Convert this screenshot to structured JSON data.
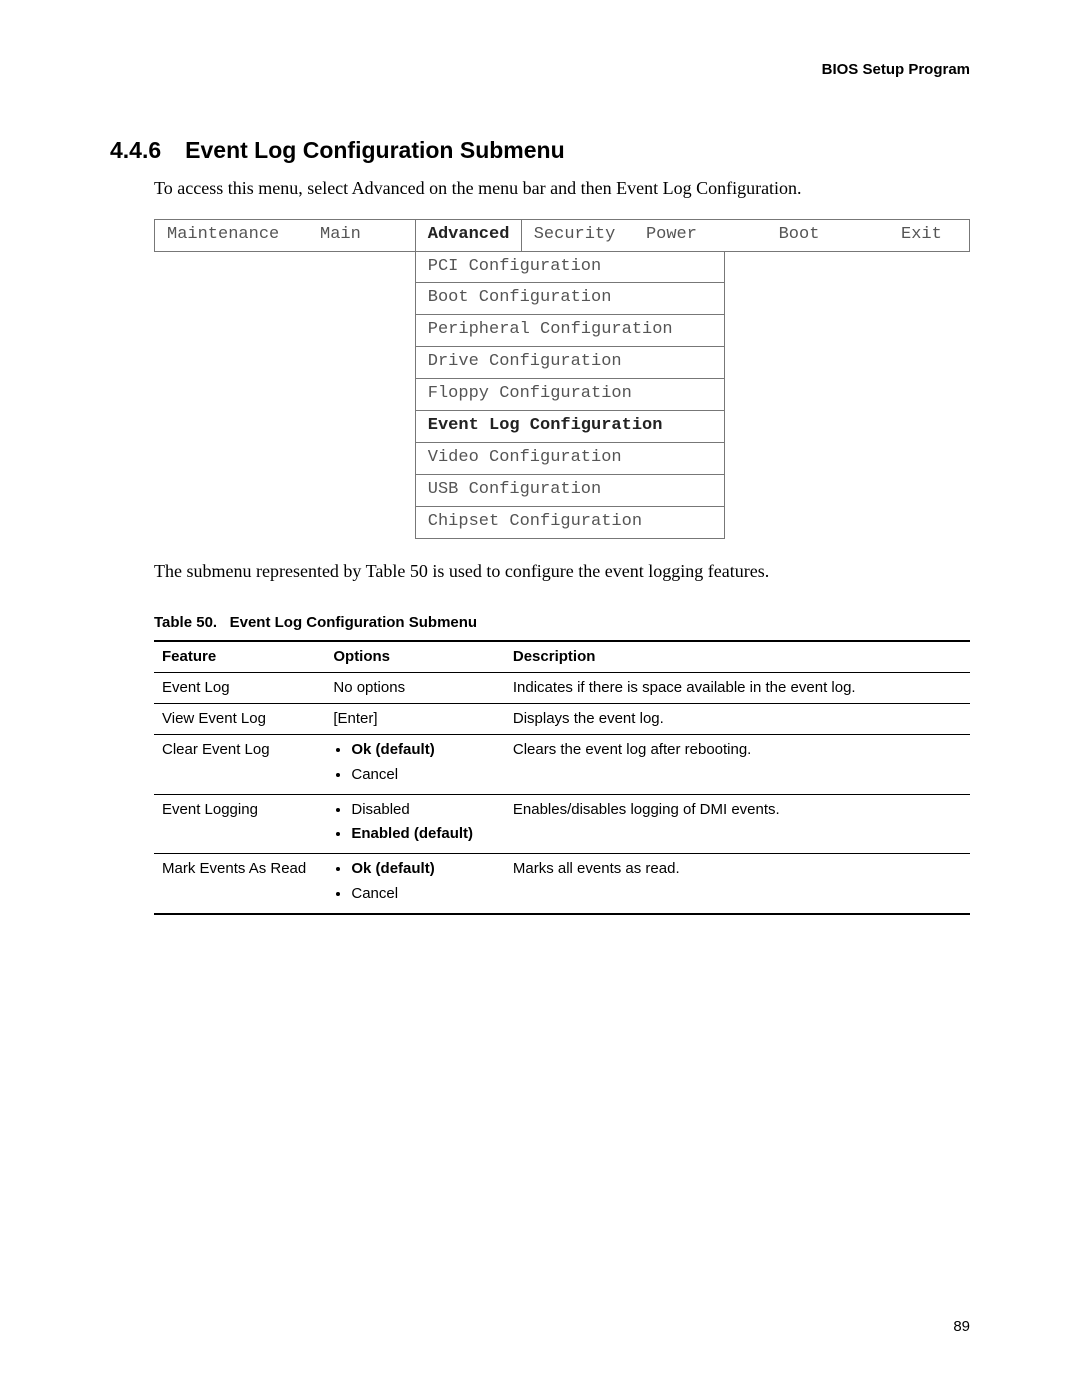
{
  "running_head": "BIOS Setup Program",
  "section_number": "4.4.6",
  "section_title": "Event Log Configuration Submenu",
  "intro_text": "To access this menu, select Advanced on the menu bar and then Event Log Configuration.",
  "bios_tabs": {
    "maintenance": "Maintenance",
    "main": "Main",
    "advanced": "Advanced",
    "security": "Security",
    "power": "Power",
    "boot": "Boot",
    "exit": "Exit"
  },
  "bios_submenu": [
    {
      "label": "PCI Configuration",
      "bold": false
    },
    {
      "label": "Boot Configuration",
      "bold": false
    },
    {
      "label": "Peripheral Configuration",
      "bold": false
    },
    {
      "label": "Drive Configuration",
      "bold": false
    },
    {
      "label": "Floppy Configuration",
      "bold": false
    },
    {
      "label": "Event Log Configuration",
      "bold": true
    },
    {
      "label": "Video Configuration",
      "bold": false
    },
    {
      "label": "USB Configuration",
      "bold": false
    },
    {
      "label": "Chipset Configuration",
      "bold": false
    }
  ],
  "post_figure_text": "The submenu represented by Table 50 is used to configure the event logging features.",
  "table_caption_num": "Table 50.",
  "table_caption_title": "Event Log Configuration Submenu",
  "feature_table": {
    "headers": {
      "feature": "Feature",
      "options": "Options",
      "description": "Description"
    },
    "rows": [
      {
        "feature": "Event Log",
        "options_plain": "No options",
        "options_list": [],
        "description": "Indicates if there is space available in the event log."
      },
      {
        "feature": "View Event Log",
        "options_plain": "[Enter]",
        "options_list": [],
        "description": "Displays the event log."
      },
      {
        "feature": "Clear Event Log",
        "options_plain": "",
        "options_list": [
          {
            "text": "Ok (default)",
            "bold": true
          },
          {
            "text": "Cancel",
            "bold": false
          }
        ],
        "description": "Clears the event log after rebooting."
      },
      {
        "feature": "Event Logging",
        "options_plain": "",
        "options_list": [
          {
            "text": "Disabled",
            "bold": false
          },
          {
            "text": "Enabled (default)",
            "bold": true
          }
        ],
        "description": "Enables/disables logging of DMI events."
      },
      {
        "feature": "Mark Events As Read",
        "options_plain": "",
        "options_list": [
          {
            "text": "Ok (default)",
            "bold": true
          },
          {
            "text": "Cancel",
            "bold": false
          }
        ],
        "description": "Marks all events as read."
      }
    ]
  },
  "page_number": "89"
}
